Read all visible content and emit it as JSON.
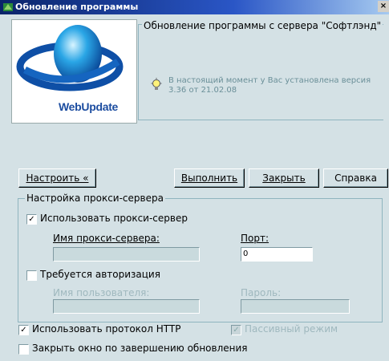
{
  "window": {
    "title": "Обновление программы",
    "close": "×"
  },
  "banner": {
    "logo_text": "WebUpdate"
  },
  "info": {
    "server_title": "Обновление программы с сервера \"Софтлэнд\"",
    "version_text": "В настоящий момент у Вас установлена версия 3.36 от 21.02.08"
  },
  "buttons": {
    "configure": "Настроить «",
    "execute": "Выполнить",
    "close": "Закрыть",
    "help": "Справка"
  },
  "proxy": {
    "group_title": "Настройка прокси-сервера",
    "use_proxy_label": "Использовать прокси-сервер",
    "use_proxy_checked": "✓",
    "server_name_label": "Имя прокси-сервера:",
    "server_name_value": "",
    "port_label": "Порт:",
    "port_value": "0",
    "auth_label": "Требуется авторизация",
    "user_label": "Имя пользователя:",
    "password_label": "Пароль:"
  },
  "options": {
    "http_label": "Использовать протокол HTTP",
    "http_checked": "✓",
    "passive_label": "Пассивный режим",
    "passive_checked": "✓",
    "close_window_label": "Закрыть окно по завершению обновления"
  }
}
